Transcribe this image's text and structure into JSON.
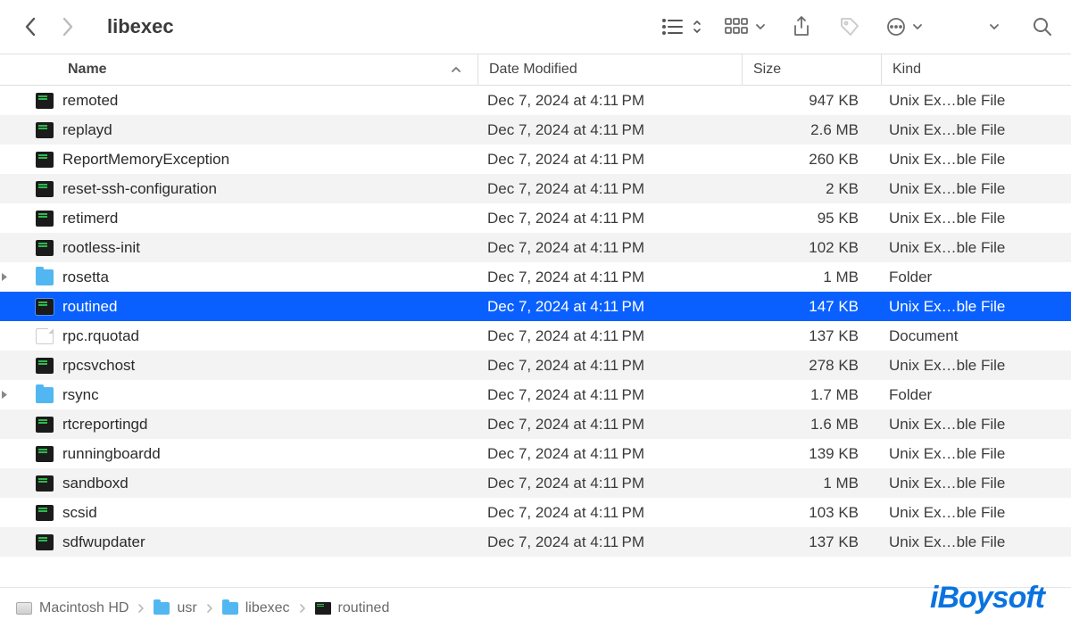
{
  "toolbar": {
    "title": "libexec"
  },
  "columns": {
    "name": "Name",
    "date": "Date Modified",
    "size": "Size",
    "kind": "Kind"
  },
  "files": [
    {
      "name": "remoted",
      "date": "Dec 7, 2024 at 4:11 PM",
      "size": "947 KB",
      "kind": "Unix Ex…ble File",
      "type": "exec",
      "expandable": false,
      "selected": false
    },
    {
      "name": "replayd",
      "date": "Dec 7, 2024 at 4:11 PM",
      "size": "2.6 MB",
      "kind": "Unix Ex…ble File",
      "type": "exec",
      "expandable": false,
      "selected": false
    },
    {
      "name": "ReportMemoryException",
      "date": "Dec 7, 2024 at 4:11 PM",
      "size": "260 KB",
      "kind": "Unix Ex…ble File",
      "type": "exec",
      "expandable": false,
      "selected": false
    },
    {
      "name": "reset-ssh-configuration",
      "date": "Dec 7, 2024 at 4:11 PM",
      "size": "2 KB",
      "kind": "Unix Ex…ble File",
      "type": "exec",
      "expandable": false,
      "selected": false
    },
    {
      "name": "retimerd",
      "date": "Dec 7, 2024 at 4:11 PM",
      "size": "95 KB",
      "kind": "Unix Ex…ble File",
      "type": "exec",
      "expandable": false,
      "selected": false
    },
    {
      "name": "rootless-init",
      "date": "Dec 7, 2024 at 4:11 PM",
      "size": "102 KB",
      "kind": "Unix Ex…ble File",
      "type": "exec",
      "expandable": false,
      "selected": false
    },
    {
      "name": "rosetta",
      "date": "Dec 7, 2024 at 4:11 PM",
      "size": "1 MB",
      "kind": "Folder",
      "type": "folder",
      "expandable": true,
      "selected": false
    },
    {
      "name": "routined",
      "date": "Dec 7, 2024 at 4:11 PM",
      "size": "147 KB",
      "kind": "Unix Ex…ble File",
      "type": "exec",
      "expandable": false,
      "selected": true
    },
    {
      "name": "rpc.rquotad",
      "date": "Dec 7, 2024 at 4:11 PM",
      "size": "137 KB",
      "kind": "Document",
      "type": "doc",
      "expandable": false,
      "selected": false
    },
    {
      "name": "rpcsvchost",
      "date": "Dec 7, 2024 at 4:11 PM",
      "size": "278 KB",
      "kind": "Unix Ex…ble File",
      "type": "exec",
      "expandable": false,
      "selected": false
    },
    {
      "name": "rsync",
      "date": "Dec 7, 2024 at 4:11 PM",
      "size": "1.7 MB",
      "kind": "Folder",
      "type": "folder",
      "expandable": true,
      "selected": false
    },
    {
      "name": "rtcreportingd",
      "date": "Dec 7, 2024 at 4:11 PM",
      "size": "1.6 MB",
      "kind": "Unix Ex…ble File",
      "type": "exec",
      "expandable": false,
      "selected": false
    },
    {
      "name": "runningboardd",
      "date": "Dec 7, 2024 at 4:11 PM",
      "size": "139 KB",
      "kind": "Unix Ex…ble File",
      "type": "exec",
      "expandable": false,
      "selected": false
    },
    {
      "name": "sandboxd",
      "date": "Dec 7, 2024 at 4:11 PM",
      "size": "1 MB",
      "kind": "Unix Ex…ble File",
      "type": "exec",
      "expandable": false,
      "selected": false
    },
    {
      "name": "scsid",
      "date": "Dec 7, 2024 at 4:11 PM",
      "size": "103 KB",
      "kind": "Unix Ex…ble File",
      "type": "exec",
      "expandable": false,
      "selected": false
    },
    {
      "name": "sdfwupdater",
      "date": "Dec 7, 2024 at 4:11 PM",
      "size": "137 KB",
      "kind": "Unix Ex…ble File",
      "type": "exec",
      "expandable": false,
      "selected": false
    }
  ],
  "path": {
    "segments": [
      {
        "label": "Macintosh HD",
        "icon": "hd"
      },
      {
        "label": "usr",
        "icon": "folder"
      },
      {
        "label": "libexec",
        "icon": "folder"
      },
      {
        "label": "routined",
        "icon": "exec"
      }
    ]
  },
  "watermark": "iBoysoft"
}
